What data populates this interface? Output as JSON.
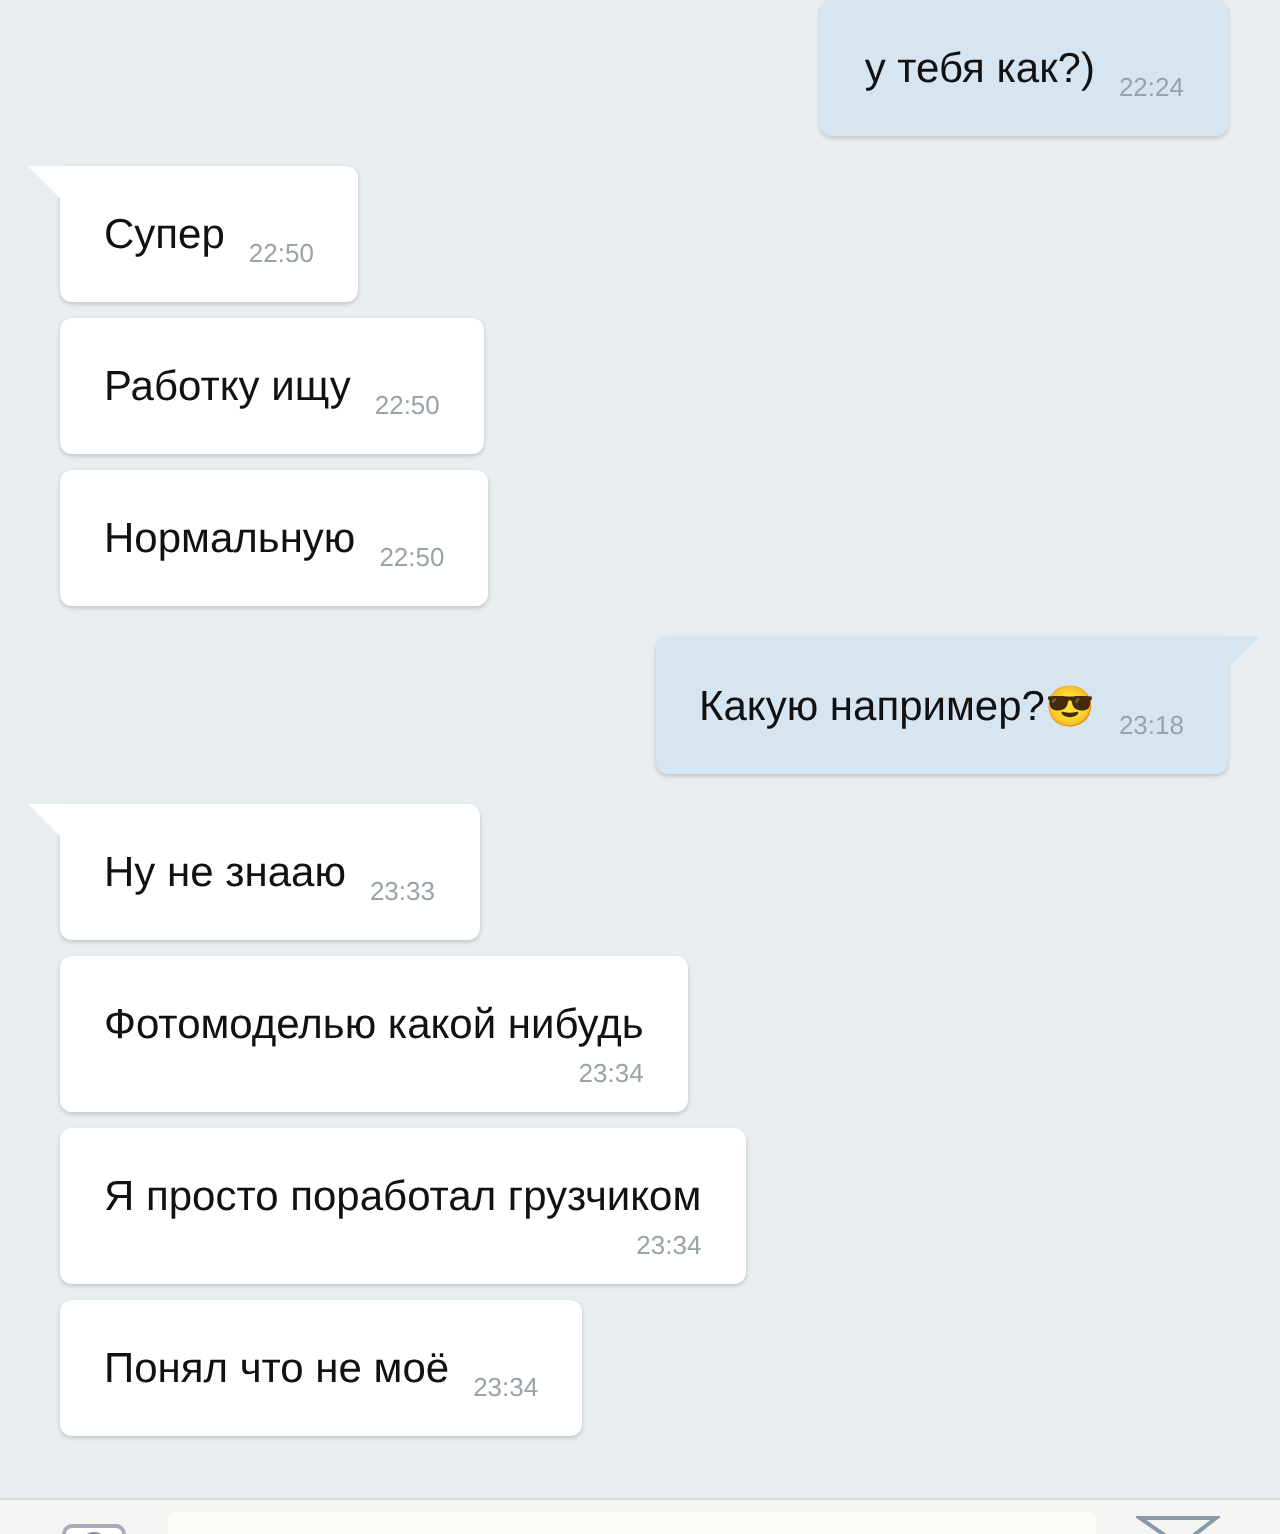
{
  "messages": [
    {
      "outgoing": true,
      "text": "у тебя как?)",
      "time": "22:24",
      "time_below": false
    },
    {
      "outgoing": false,
      "group_start": true,
      "text": "Супер",
      "time": "22:50",
      "time_below": false
    },
    {
      "outgoing": false,
      "group_start": false,
      "text": "Работку ищу",
      "time": "22:50",
      "time_below": false
    },
    {
      "outgoing": false,
      "group_start": false,
      "text": "Нормальную",
      "time": "22:50",
      "time_below": false
    },
    {
      "outgoing": true,
      "group_start": true,
      "text": "Какую например?",
      "emoji": "😎",
      "time": "23:18",
      "time_below": false
    },
    {
      "outgoing": false,
      "group_start": true,
      "text": "Ну не знааю",
      "time": "23:33",
      "time_below": false
    },
    {
      "outgoing": false,
      "group_start": false,
      "text": "Фотомоделью какой нибудь",
      "time": "23:34",
      "time_below": true
    },
    {
      "outgoing": false,
      "group_start": false,
      "text": "Я просто поработал грузчиком",
      "time": "23:34",
      "time_below": true
    },
    {
      "outgoing": false,
      "group_start": false,
      "text": "Понял что не моё",
      "time": "23:34",
      "time_below": false
    }
  ],
  "composer": {
    "camera": true,
    "send": true
  }
}
